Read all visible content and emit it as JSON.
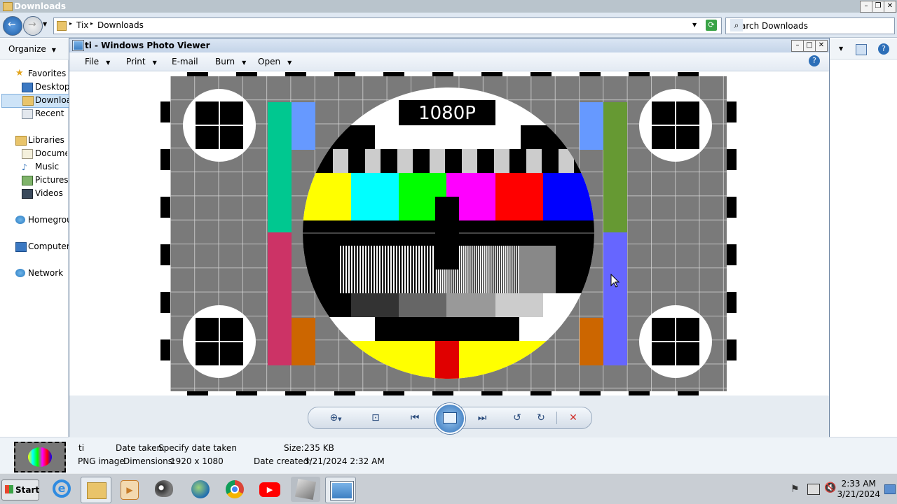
{
  "explorer": {
    "title": "Downloads",
    "breadcrumb": [
      "Tix",
      "Downloads"
    ],
    "search_placeholder": "Search Downloads",
    "organize_label": "Organize",
    "nav": {
      "favorites": "Favorites",
      "desktop": "Desktop",
      "downloads": "Downloads",
      "recent": "Recent Places",
      "libraries": "Libraries",
      "documents": "Documents",
      "music": "Music",
      "pictures": "Pictures",
      "videos": "Videos",
      "homegroup": "Homegroup",
      "computer": "Computer",
      "network": "Network"
    },
    "details": {
      "name": "ti",
      "type": "PNG image",
      "date_taken_label": "Date taken:",
      "date_taken_value": "Specify date taken",
      "dimensions_label": "Dimensions:",
      "dimensions_value": "1920 x 1080",
      "size_label": "Size:",
      "size_value": "235 KB",
      "date_created_label": "Date created:",
      "date_created_value": "3/21/2024 2:32 AM"
    }
  },
  "viewer": {
    "title": "ti - Windows Photo Viewer",
    "menu": [
      "File",
      "Print",
      "E-mail",
      "Burn",
      "Open"
    ],
    "image_label": "1080P"
  },
  "taskbar": {
    "start_label": "Start",
    "time": "2:33 AM",
    "date": "3/21/2024"
  },
  "colors": {
    "accent": "#2d6fb8",
    "close_red": "#d0302a"
  }
}
